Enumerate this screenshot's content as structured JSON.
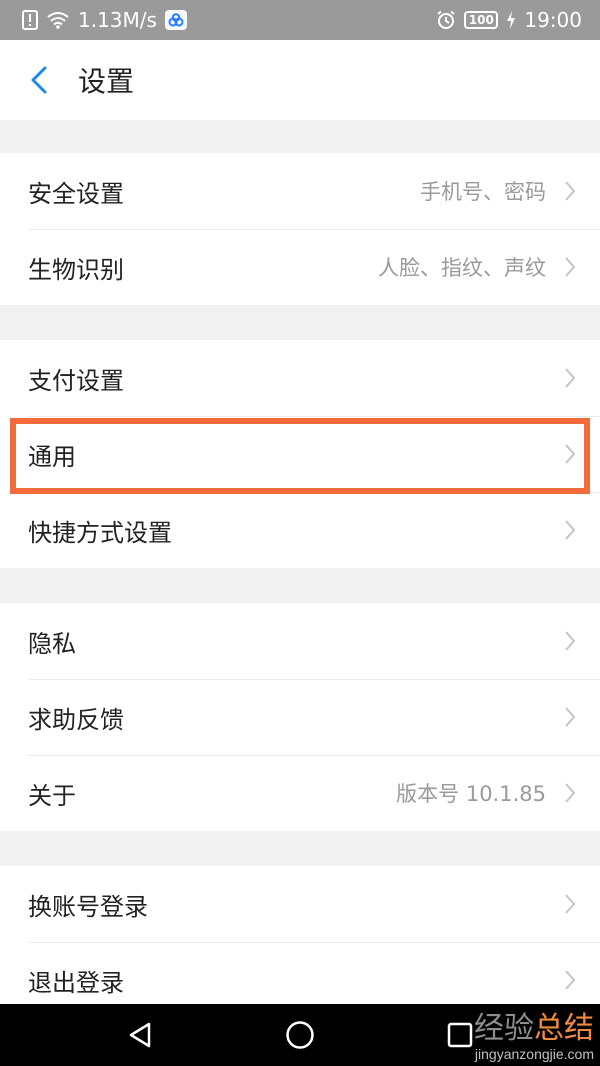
{
  "status_bar": {
    "speed": "1.13M/s",
    "battery": "100",
    "time": "19:00",
    "icons": [
      "alert-icon",
      "wifi-icon",
      "cloud-app-icon",
      "alarm-icon",
      "battery-icon",
      "charging-icon"
    ]
  },
  "header": {
    "title": "设置"
  },
  "groups": [
    {
      "items": [
        {
          "label": "安全设置",
          "value": "手机号、密码"
        },
        {
          "label": "生物识别",
          "value": "人脸、指纹、声纹"
        }
      ]
    },
    {
      "items": [
        {
          "label": "支付设置",
          "value": ""
        },
        {
          "label": "通用",
          "value": ""
        },
        {
          "label": "快捷方式设置",
          "value": ""
        }
      ]
    },
    {
      "items": [
        {
          "label": "隐私",
          "value": ""
        },
        {
          "label": "求助反馈",
          "value": ""
        },
        {
          "label": "关于",
          "value": "版本号 10.1.85"
        }
      ]
    },
    {
      "items": [
        {
          "label": "换账号登录",
          "value": ""
        },
        {
          "label": "退出登录",
          "value": ""
        }
      ]
    }
  ],
  "watermark": {
    "main_a": "经验",
    "main_b": "总结",
    "url": "jingyanzongjie.com"
  },
  "colors": {
    "highlight": "#f26b3a",
    "accent": "#1e88e5"
  }
}
